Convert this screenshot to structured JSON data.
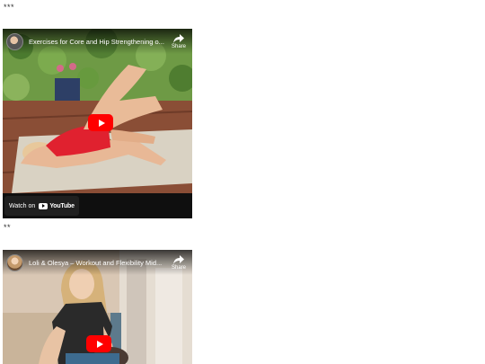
{
  "separators": [
    "***",
    "**"
  ],
  "videos": [
    {
      "title": "Exercises for Core and Hip Strengthening o...",
      "share_label": "Share",
      "watch_label": "Watch on",
      "brand": "YouTube"
    },
    {
      "title": "Loli & Olesya – Workout and Flexibility Mid...",
      "share_label": "Share"
    }
  ],
  "colors": {
    "play_button": "#ff0000",
    "watch_bar": "#0f0f0f"
  },
  "icons": [
    "channel-avatar",
    "share-icon",
    "play-icon",
    "youtube-logo"
  ]
}
